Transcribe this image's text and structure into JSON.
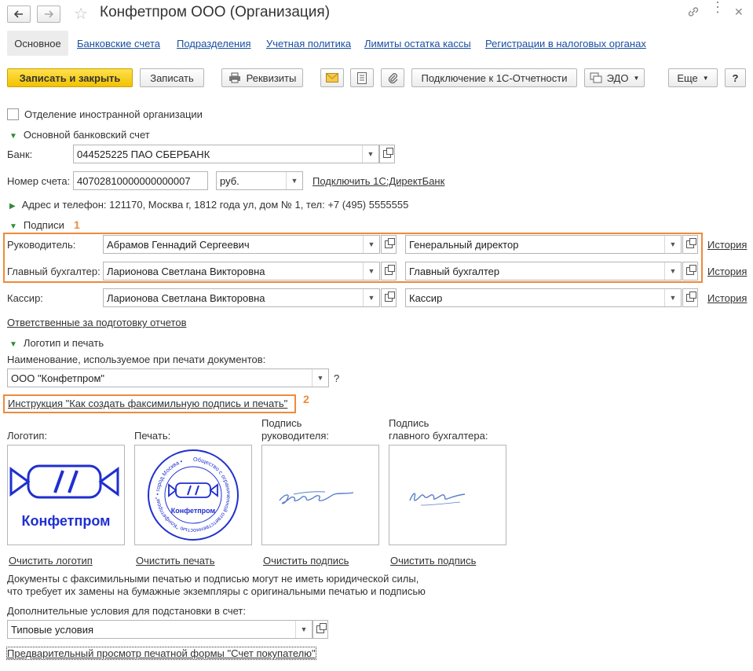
{
  "window": {
    "title": "Конфетпром ООО (Организация)",
    "back_icon": "arrow-left-icon",
    "forward_icon": "arrow-right-icon",
    "star_icon": "star-icon",
    "link_icon": "link-icon",
    "menu_icon": "vertical-dots-icon",
    "close_icon": "close-icon"
  },
  "tabs": [
    "Основное",
    "Банковские счета",
    "Подразделения",
    "Учетная политика",
    "Лимиты остатка кассы",
    "Регистрации в налоговых органах"
  ],
  "toolbar": {
    "save_close": "Записать и закрыть",
    "save": "Записать",
    "requisites": "Реквизиты",
    "connect": "Подключение к 1С-Отчетности",
    "edo": "ЭДО",
    "more": "Еще",
    "help": "?"
  },
  "foreign_branch": "Отделение иностранной организации",
  "bank_section": {
    "title": "Основной банковский счет",
    "bank_label": "Банк:",
    "bank_value": "044525225 ПАО СБЕРБАНК",
    "account_label": "Номер счета:",
    "account_value": "40702810000000000007",
    "currency": "руб.",
    "direct_bank": "Подключить 1С:ДиректБанк"
  },
  "address_line": "Адрес и телефон: 121170, Москва г, 1812 года ул, дом № 1, тел: +7 (495) 5555555",
  "signatures": {
    "title": "Подписи",
    "rows": [
      {
        "label": "Руководитель:",
        "person": "Абрамов Геннадий Сергеевич",
        "position": "Генеральный директор",
        "history": "История"
      },
      {
        "label": "Главный бухгалтер:",
        "person": "Ларионова Светлана Викторовна",
        "position": "Главный бухгалтер",
        "history": "История"
      },
      {
        "label": "Кассир:",
        "person": "Ларионова Светлана Викторовна",
        "position": "Кассир",
        "history": "История"
      }
    ],
    "responsible_link": "Ответственные за подготовку отчетов"
  },
  "logo_section": {
    "title": "Логотип и печать",
    "name_label": "Наименование, используемое при печати документов:",
    "name_value": "ООО \"Конфетпром\"",
    "help": "?",
    "instruction_link": "Инструкция \"Как создать факсимильную подпись и печать\"",
    "logo_label": "Логотип:",
    "stamp_label": "Печать:",
    "head_sign_label_1": "Подпись",
    "head_sign_label_2": "руководителя:",
    "acc_sign_label_1": "Подпись",
    "acc_sign_label_2": "главного бухгалтера:",
    "logo_text": "Конфетпром",
    "stamp_center": "Конфетпром",
    "stamp_ring": "Общество с ограниченной ответственностью \"Конфетпром\" • город Москва •",
    "clear_logo": "Очистить логотип",
    "clear_stamp": "Очистить печать",
    "clear_sign1": "Очистить подпись",
    "clear_sign2": "Очистить подпись",
    "note_1": "Документы с факсимильными печатью и подписью могут не иметь юридической силы,",
    "note_2": "что требует их замены на бумажные экземпляры с оригинальными печатью и подписью"
  },
  "conditions": {
    "label": "Дополнительные условия для подстановки в счет:",
    "value": "Типовые условия"
  },
  "preview_link": "Предварительный просмотр печатной формы \"Счет покупателю\"",
  "annotations": [
    "1",
    "2"
  ],
  "colors": {
    "accent": "#f2c200",
    "link": "#1a4fa0",
    "group": "#2e8b3a",
    "annotation": "#ef8a3a",
    "brand_blue": "#1f2fd0"
  }
}
